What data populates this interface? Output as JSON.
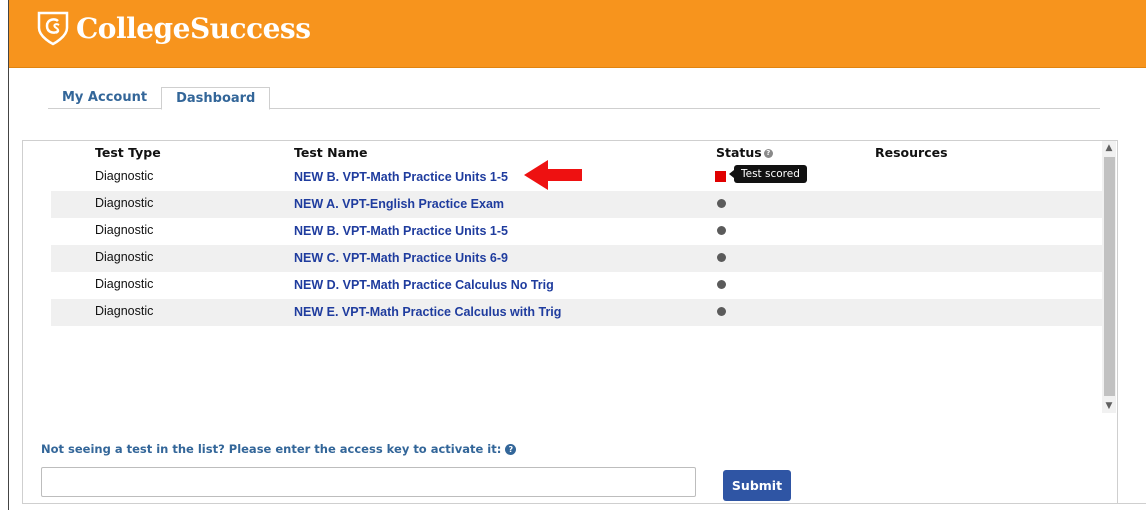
{
  "app": {
    "title": "CollegeSuccess",
    "brand_color": "#f7941d",
    "logo_icon": "cs-shield-logo"
  },
  "tabs": [
    {
      "label": "My Account",
      "active": false
    },
    {
      "label": "Dashboard",
      "active": true
    }
  ],
  "table": {
    "headers": {
      "test_type": "Test Type",
      "test_name": "Test Name",
      "status": "Status",
      "resources": "Resources"
    },
    "rows": [
      {
        "type": "Diagnostic",
        "name": "NEW B. VPT-Math Practice Units 1-5",
        "status": "scored"
      },
      {
        "type": "Diagnostic",
        "name": "NEW A. VPT-English Practice Exam",
        "status": "pending"
      },
      {
        "type": "Diagnostic",
        "name": "NEW B. VPT-Math Practice Units 1-5",
        "status": "pending"
      },
      {
        "type": "Diagnostic",
        "name": "NEW C. VPT-Math Practice Units 6-9",
        "status": "pending"
      },
      {
        "type": "Diagnostic",
        "name": "NEW D. VPT-Math Practice Calculus No Trig",
        "status": "pending"
      },
      {
        "type": "Diagnostic",
        "name": "NEW E. VPT-Math Practice Calculus with Trig",
        "status": "pending"
      }
    ],
    "tooltip": "Test scored",
    "status_colors": {
      "scored": "#e00000",
      "pending": "#5b5b5b"
    }
  },
  "annotation": {
    "icon": "red-arrow-left",
    "color": "#ee1111"
  },
  "access": {
    "label": "Not seeing a test in the list? Please enter the access key to activate it:",
    "input_value": "",
    "submit_label": "Submit"
  }
}
